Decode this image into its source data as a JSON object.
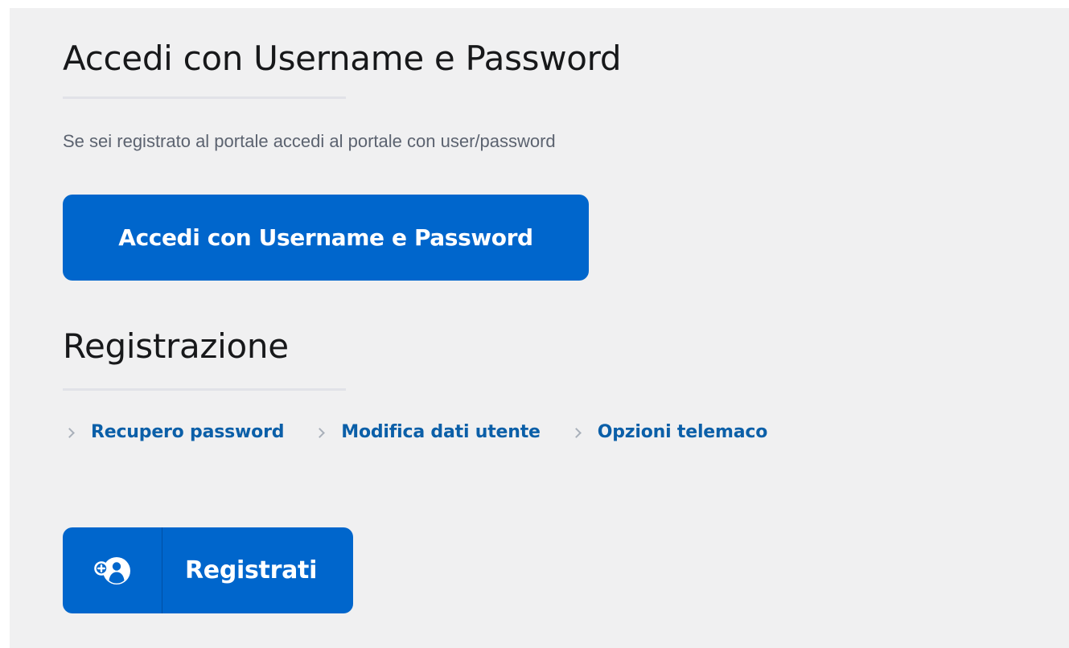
{
  "login": {
    "title": "Accedi con Username e Password",
    "description": "Se sei registrato al portale accedi al portale con user/password",
    "button_label": "Accedi con Username e Password"
  },
  "registration": {
    "title": "Registrazione",
    "links": [
      {
        "label": "Recupero password"
      },
      {
        "label": "Modifica dati utente"
      },
      {
        "label": "Opzioni telemaco"
      }
    ],
    "register_button": {
      "label": "Registrati",
      "icon": "user-add-icon"
    }
  },
  "colors": {
    "primary": "#0066cc",
    "link": "#0b5fa8",
    "background": "#f0f0f1",
    "title": "#17181a",
    "muted_text": "#5c6370"
  }
}
